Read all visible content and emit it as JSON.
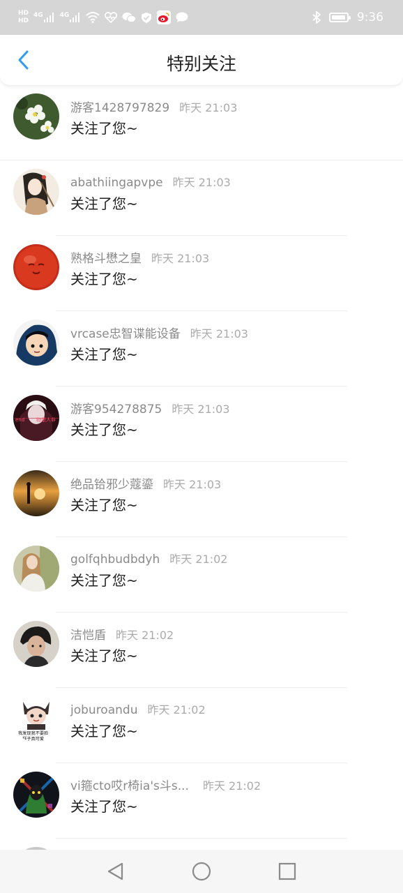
{
  "status_bar": {
    "left_icons": [
      "hd-icon",
      "signal-4g-icon",
      "signal-4g-icon",
      "wifi-icon",
      "health-icon",
      "wechat-icon",
      "shield-icon",
      "weibo-icon",
      "message-icon"
    ],
    "hd_label_top": "HD",
    "hd_label_bottom": "HD",
    "net_label": "4G",
    "battery_level": 0.85,
    "time": "9:36"
  },
  "header": {
    "title": "特别关注"
  },
  "follow_message": "关注了您~",
  "items": [
    {
      "name": "游客1428797829",
      "time": "昨天 21:03"
    },
    {
      "name": "abathiingapvpe",
      "time": "昨天 21:03"
    },
    {
      "name": "熟格斗懋之皇",
      "time": "昨天 21:03"
    },
    {
      "name": "vrcase忠智谍能设备",
      "time": "昨天 21:03"
    },
    {
      "name": "游客954278875",
      "time": "昨天 21:03"
    },
    {
      "name": "绝品铪邪少蔻鎏",
      "time": "昨天 21:03"
    },
    {
      "name": "golfqhbudbdyh",
      "time": "昨天 21:02"
    },
    {
      "name": "洁恺盾",
      "time": "昨天 21:02"
    },
    {
      "name": "joburoandu",
      "time": "昨天 21:02"
    },
    {
      "name": "vi箍cto哎r椅ia's斗s...",
      "time": "昨天 21:02"
    }
  ],
  "avatar_texts": {
    "item5": [
      "end",
      "物是人非"
    ],
    "item9": [
      "我发现我不要脸",
      "*样子真可爱"
    ]
  },
  "colors": {
    "accent": "#2e9cf0",
    "name": "#8a8a8a",
    "time": "#ababab",
    "status_bar": "#d6d6d6"
  }
}
